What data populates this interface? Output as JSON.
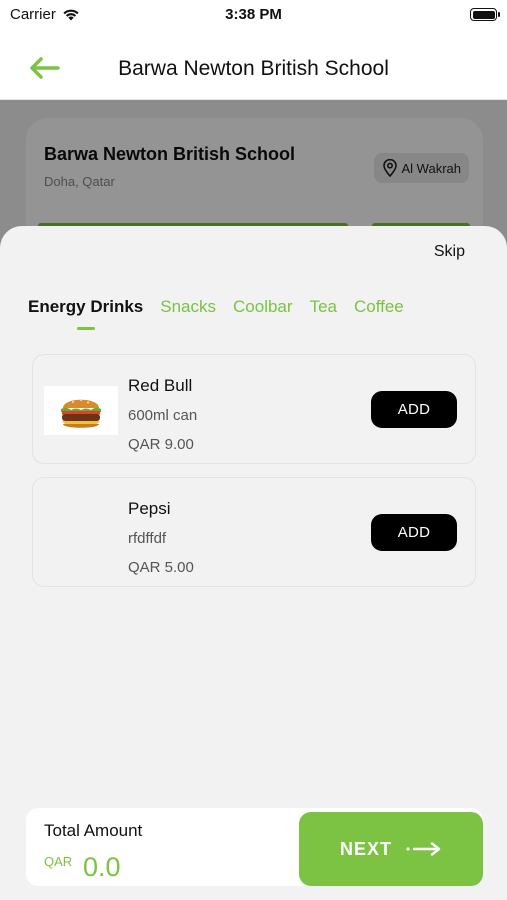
{
  "status_bar": {
    "carrier": "Carrier",
    "time": "3:38 PM"
  },
  "header": {
    "title": "Barwa Newton British School",
    "back_icon": "arrow-left-icon"
  },
  "school_card": {
    "name": "Barwa Newton British School",
    "city": "Doha, Qatar",
    "area": "Al Wakrah"
  },
  "sheet": {
    "skip_label": "Skip",
    "tabs": [
      {
        "label": "Energy Drinks",
        "active": true
      },
      {
        "label": "Snacks",
        "active": false
      },
      {
        "label": "Coolbar",
        "active": false
      },
      {
        "label": "Tea",
        "active": false
      },
      {
        "label": "Coffee",
        "active": false
      }
    ],
    "products": [
      {
        "name": "Red Bull",
        "description": "600ml can",
        "price": "QAR 9.00",
        "button": "ADD",
        "image_icon": "burger-icon"
      },
      {
        "name": "Pepsi",
        "description": "rfdffdf",
        "price": "QAR 5.00",
        "button": "ADD"
      }
    ]
  },
  "footer": {
    "total_label": "Total Amount",
    "currency": "QAR",
    "amount": "0.0",
    "next_label": "NEXT"
  },
  "colors": {
    "accent": "#7cc243",
    "button_dark": "#000000",
    "sheet_bg": "#f2f2f2"
  }
}
